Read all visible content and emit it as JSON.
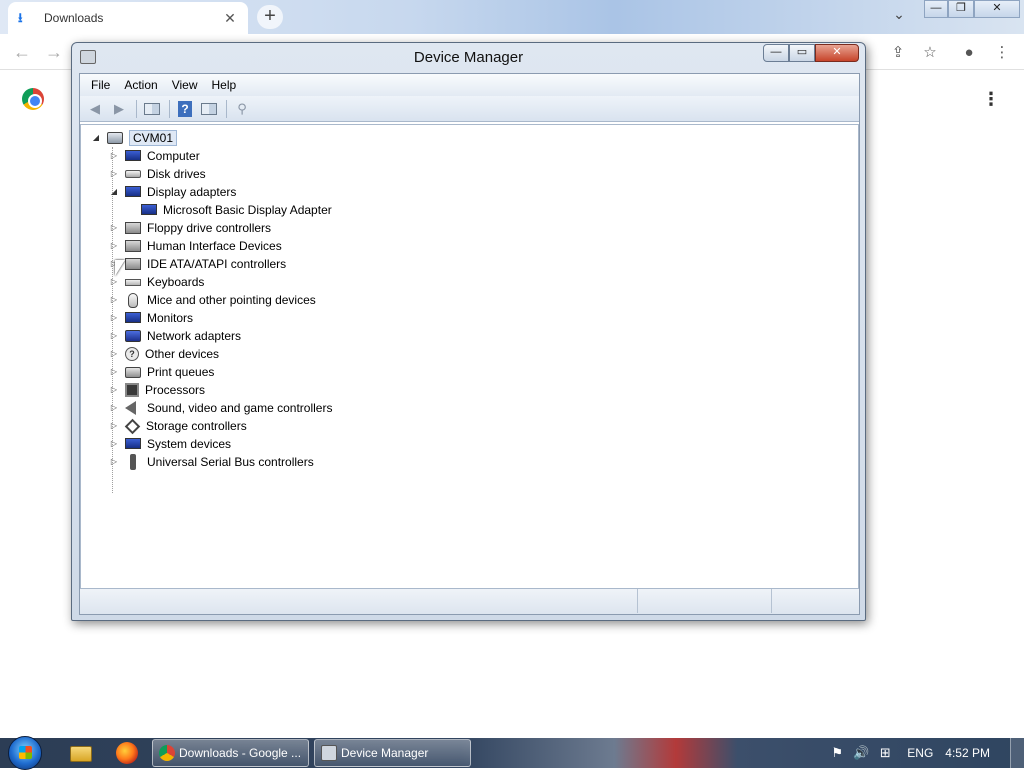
{
  "browser": {
    "tab_title": "Downloads",
    "tab_close": "✕",
    "new_tab": "+",
    "tab_search": "⌄",
    "window_controls": {
      "minimize": "—",
      "restore": "❐",
      "close": "✕"
    },
    "nav": {
      "back": "←",
      "forward": "→"
    },
    "toolbar_icons": [
      "share-icon",
      "star-icon",
      "profile-icon",
      "kebab-icon"
    ],
    "toolbar_glyphs": {
      "share": "⇪",
      "star": "☆",
      "profile": "●",
      "menu": "⋮"
    },
    "page_menu": "⋮"
  },
  "device_manager": {
    "title": "Device Manager",
    "window_controls": {
      "minimize": "—",
      "maximize": "▭",
      "close": "✕"
    },
    "menu": [
      "File",
      "Action",
      "View",
      "Help"
    ],
    "toolbar_glyphs": {
      "back": "◀",
      "forward": "▶",
      "help": "?",
      "scan": "⚲"
    },
    "root": "CVM01",
    "nodes": [
      {
        "label": "Computer",
        "icon": "monitor",
        "expanded": false
      },
      {
        "label": "Disk drives",
        "icon": "disk",
        "expanded": false
      },
      {
        "label": "Display adapters",
        "icon": "monitor",
        "expanded": true,
        "children": [
          "Microsoft Basic Display Adapter"
        ]
      },
      {
        "label": "Floppy drive controllers",
        "icon": "gray",
        "expanded": false
      },
      {
        "label": "Human Interface Devices",
        "icon": "gray",
        "expanded": false
      },
      {
        "label": "IDE ATA/ATAPI controllers",
        "icon": "gray",
        "expanded": false
      },
      {
        "label": "Keyboards",
        "icon": "keyboard",
        "expanded": false
      },
      {
        "label": "Mice and other pointing devices",
        "icon": "mouse",
        "expanded": false
      },
      {
        "label": "Monitors",
        "icon": "monitor",
        "expanded": false
      },
      {
        "label": "Network adapters",
        "icon": "network",
        "expanded": false
      },
      {
        "label": "Other devices",
        "icon": "unknown",
        "expanded": false
      },
      {
        "label": "Print queues",
        "icon": "printer",
        "expanded": false
      },
      {
        "label": "Processors",
        "icon": "chip",
        "expanded": false
      },
      {
        "label": "Sound, video and game controllers",
        "icon": "speaker",
        "expanded": false
      },
      {
        "label": "Storage controllers",
        "icon": "storage",
        "expanded": false
      },
      {
        "label": "System devices",
        "icon": "monitor",
        "expanded": false
      },
      {
        "label": "Universal Serial Bus controllers",
        "icon": "usb",
        "expanded": false
      }
    ],
    "expander_glyphs": {
      "collapsed": "▷",
      "expanded": "◢"
    }
  },
  "taskbar": {
    "tasks": [
      "Downloads - Google ...",
      "Device Manager"
    ],
    "tray": {
      "language": "ENG",
      "time": "4:52 PM"
    },
    "tray_glyphs": {
      "flag": "⚑",
      "volume": "🔊",
      "network": "⊞"
    }
  }
}
